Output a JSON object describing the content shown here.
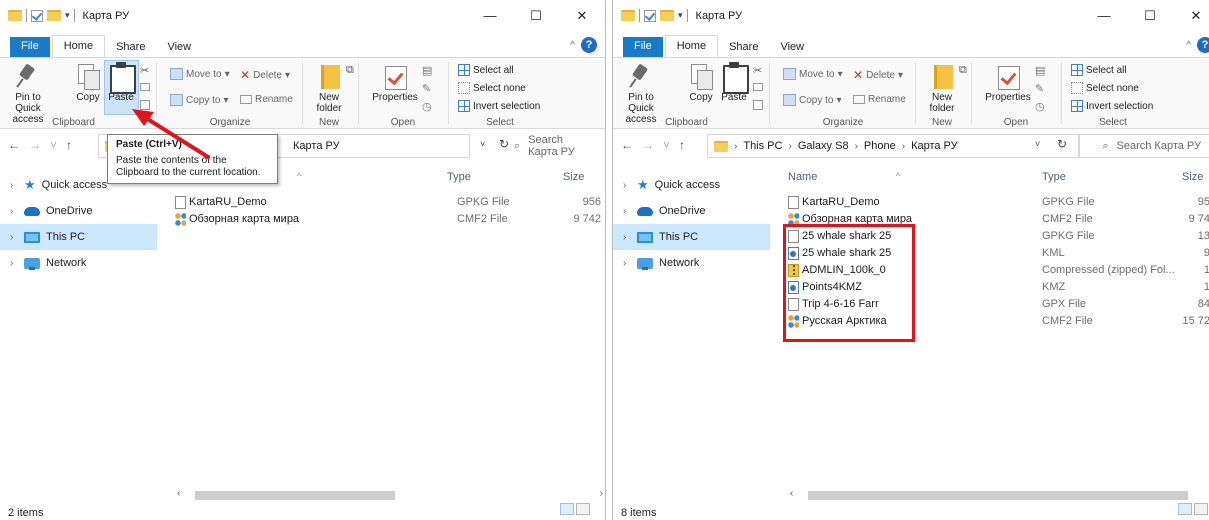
{
  "left": {
    "title": "Карта РУ",
    "tabs": [
      "File",
      "Home",
      "Share",
      "View"
    ],
    "ribbon": {
      "clipboard": {
        "pin": "Pin to Quick access",
        "copy": "Copy",
        "paste": "Paste",
        "label": "Clipboard"
      },
      "organize": {
        "move_to": "Move to",
        "copy_to": "Copy to",
        "delete": "Delete",
        "rename": "Rename",
        "label": "Organize"
      },
      "new": {
        "new_folder": "New folder",
        "label": "New"
      },
      "open": {
        "properties": "Properties",
        "label": "Open"
      },
      "select": {
        "select_all": "Select all",
        "select_none": "Select none",
        "invert": "Invert selection",
        "label": "Select"
      }
    },
    "address": {
      "crumbs": [
        "Карта РУ"
      ]
    },
    "search_placeholder": "Search Карта РУ",
    "nav": [
      "Quick access",
      "OneDrive",
      "This PC",
      "Network"
    ],
    "columns": {
      "name": "",
      "type": "Type",
      "size": "Size"
    },
    "files": [
      {
        "name": "KartaRU_Demo",
        "type": "GPKG File",
        "size": "956",
        "icon": "doc"
      },
      {
        "name": "Обзорная карта мира",
        "type": "CMF2 File",
        "size": "9 742",
        "icon": "cmf"
      }
    ],
    "status": "2 items",
    "tooltip": {
      "title": "Paste (Ctrl+V)",
      "body": "Paste the contents of the Clipboard to the current location."
    }
  },
  "right": {
    "title": "Карта РУ",
    "tabs": [
      "File",
      "Home",
      "Share",
      "View"
    ],
    "ribbon": {
      "clipboard": {
        "pin": "Pin to Quick access",
        "copy": "Copy",
        "paste": "Paste",
        "label": "Clipboard"
      },
      "organize": {
        "move_to": "Move to",
        "copy_to": "Copy to",
        "delete": "Delete",
        "rename": "Rename",
        "label": "Organize"
      },
      "new": {
        "new_folder": "New folder",
        "label": "New"
      },
      "open": {
        "properties": "Properties",
        "label": "Open"
      },
      "select": {
        "select_all": "Select all",
        "select_none": "Select none",
        "invert": "Invert selection",
        "label": "Select"
      }
    },
    "address": {
      "crumbs": [
        "This PC",
        "Galaxy S8",
        "Phone",
        "Карта РУ"
      ]
    },
    "search_placeholder": "Search Карта РУ",
    "nav": [
      "Quick access",
      "OneDrive",
      "This PC",
      "Network"
    ],
    "columns": {
      "name": "Name",
      "type": "Type",
      "size": "Size"
    },
    "files": [
      {
        "name": "KartaRU_Demo",
        "type": "GPKG File",
        "size": "95",
        "icon": "doc"
      },
      {
        "name": "Обзорная карта мира",
        "type": "CMF2 File",
        "size": "9 74",
        "icon": "cmf"
      },
      {
        "name": "25 whale shark 25",
        "type": "GPKG File",
        "size": "13",
        "icon": "doc"
      },
      {
        "name": "25 whale shark 25",
        "type": "KML",
        "size": "9",
        "icon": "kml"
      },
      {
        "name": "ADMLIN_100k_0",
        "type": "Compressed (zipped) Fol...",
        "size": "1",
        "icon": "zip"
      },
      {
        "name": "Points4KMZ",
        "type": "KMZ",
        "size": "1",
        "icon": "kml"
      },
      {
        "name": "Trip 4-6-16 Farr",
        "type": "GPX File",
        "size": "84",
        "icon": "doc"
      },
      {
        "name": "Русская Арктика",
        "type": "CMF2 File",
        "size": "15 72",
        "icon": "cmf"
      }
    ],
    "status": "8 items"
  },
  "colors": {
    "accent": "#1979ca",
    "selected_nav": "#cce8ff",
    "highlight": "#e1131b"
  }
}
